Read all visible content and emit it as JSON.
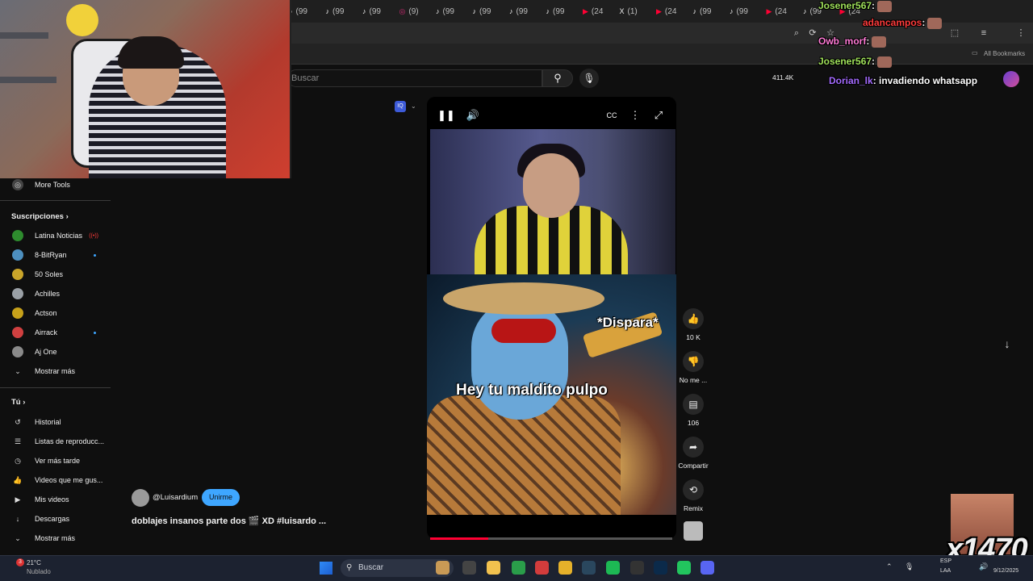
{
  "browser": {
    "tabs": [
      {
        "icon": "tiktok-icon",
        "label": "(99"
      },
      {
        "icon": "tiktok-icon",
        "label": "(99"
      },
      {
        "icon": "tiktok-icon",
        "label": "(99"
      },
      {
        "icon": "instagram-icon",
        "label": "(9)"
      },
      {
        "icon": "tiktok-icon",
        "label": "(99"
      },
      {
        "icon": "tiktok-icon",
        "label": "(99"
      },
      {
        "icon": "tiktok-icon",
        "label": "(99"
      },
      {
        "icon": "tiktok-icon",
        "label": "(99"
      },
      {
        "icon": "youtube-icon",
        "label": "(24"
      },
      {
        "icon": "x-icon",
        "label": "(1)"
      },
      {
        "icon": "youtube-icon",
        "label": "(24"
      },
      {
        "icon": "tiktok-icon",
        "label": "(99"
      },
      {
        "icon": "tiktok-icon",
        "label": "(99"
      },
      {
        "icon": "youtube-icon",
        "label": "(24"
      },
      {
        "icon": "tiktok-icon",
        "label": "(99"
      },
      {
        "icon": "youtube-icon",
        "label": "(24"
      }
    ],
    "all_bookmarks": "All Bookmarks"
  },
  "youtube": {
    "search_placeholder": "Buscar",
    "views": "411.4K"
  },
  "sidebar": {
    "more_tools": "More Tools",
    "subscriptions_title": "Suscripciones",
    "subscriptions": [
      {
        "label": "Latina Noticias",
        "badge": "live"
      },
      {
        "label": "8-BitRyan",
        "badge": "dot"
      },
      {
        "label": "50 Soles",
        "badge": ""
      },
      {
        "label": "Achilles",
        "badge": ""
      },
      {
        "label": "Actson",
        "badge": ""
      },
      {
        "label": "Airrack",
        "badge": "dot"
      },
      {
        "label": "Aj One",
        "badge": ""
      }
    ],
    "show_more": "Mostrar más",
    "you_title": "Tú",
    "you_items": [
      {
        "label": "Historial",
        "icon": "history-icon"
      },
      {
        "label": "Listas de reproducc...",
        "icon": "playlist-icon"
      },
      {
        "label": "Ver más tarde",
        "icon": "clock-icon"
      },
      {
        "label": "Videos que me gus...",
        "icon": "thumbs-up-icon"
      },
      {
        "label": "Mis videos",
        "icon": "my-videos-icon"
      },
      {
        "label": "Descargas",
        "icon": "download-icon"
      }
    ],
    "show_more_2": "Mostrar más"
  },
  "short": {
    "overlay_dispara": "*Dispara*",
    "overlay_caption": "Hey tu maldito pulpo",
    "progress": 0.24,
    "channel": "@Luisardium",
    "join_label": "Unirme",
    "title": "doblajes insanos parte dos 🎬 XD #luisardo ...",
    "actions": [
      {
        "icon": "thumbs-up-icon",
        "label": "10 K"
      },
      {
        "icon": "thumbs-down-icon",
        "label": "No me ..."
      },
      {
        "icon": "comment-icon",
        "label": "106"
      },
      {
        "icon": "share-icon",
        "label": "Compartir"
      },
      {
        "icon": "remix-icon",
        "label": "Remix"
      }
    ]
  },
  "chat": [
    {
      "user": "Josener567",
      "msg": ":",
      "color": "#9fe05a"
    },
    {
      "user": "adancampos",
      "msg": ":",
      "color": "#ff3b3b"
    },
    {
      "user": "Owb_morf",
      "msg": ":",
      "color": "#ff7bd6"
    },
    {
      "user": "Josener567",
      "msg": ":",
      "color": "#9fe05a"
    },
    {
      "user": "Dorian_lk",
      "msg": ": invadiendo whatsapp",
      "color": "#a46bff"
    }
  ],
  "stream_overlay": {
    "counter": "x1470"
  },
  "taskbar": {
    "temp": "21°C",
    "weather": "Nublado",
    "search": "Buscar",
    "lang": "ESP",
    "lang2": "LAA",
    "date": "9/12/2025"
  }
}
